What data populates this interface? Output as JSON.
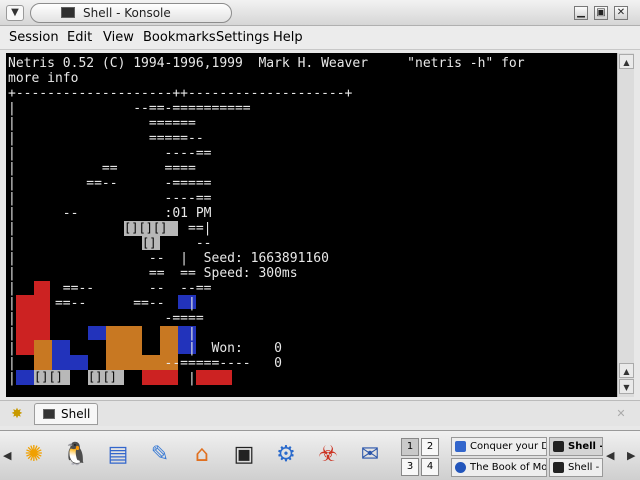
{
  "window": {
    "title": "Shell - Konsole",
    "menu_button_glyph": "▼",
    "buttons": {
      "minimize": "▁",
      "maximize": "▣",
      "close": "✕"
    }
  },
  "menubar": {
    "items": [
      "Session",
      "Edit",
      "View",
      "Bookmarks",
      "Settings",
      "Help"
    ]
  },
  "terminal": {
    "lines": [
      "Netris 0.52 (C) 1994-1996,1999  Mark H. Weaver     \"netris -h\" for",
      "more info",
      "+--------------------++--------------------+",
      "|               --==-==========",
      "|                 ======",
      "|                 =====--",
      "|                   ----==",
      "|           ==      ====",
      "|         ==--      -=====",
      "|                   ----==",
      "|      --           :01 PM",
      "|                      ==|",
      "|                       --",
      "|                 --  |  Seed: 1663891160",
      "|                 ==  == Speed: 300ms",
      "|      ==--       --  --==",
      "|     ==--      ==--   |",
      "|                   -====",
      "|                      |",
      "|                      |  Won:    0",
      "|                   --=====----   0",
      "|                      |"
    ],
    "gray_blocks": [
      "[][][]",
      "[]",
      "[][]",
      "[][]",
      "[][]"
    ],
    "block_colors": {
      "red": "#cc2222",
      "orange": "#c87822",
      "blue": "#2233bb",
      "gray": "#b8b8b8"
    }
  },
  "scrollbar": {
    "up_glyph": "▲",
    "down_glyph": "▼"
  },
  "tabbar": {
    "new_tab_icon": "new-session-icon",
    "tabs": [
      {
        "label": "Shell",
        "active": true
      }
    ],
    "close_glyph": "✕"
  },
  "panel": {
    "left_arrow": "◀",
    "right_arrow": "▶",
    "launchers": [
      {
        "name": "kde-menu-icon",
        "glyph": "✺",
        "color": "#f0a000"
      },
      {
        "name": "tux-icon",
        "glyph": "🐧",
        "color": "#000000"
      },
      {
        "name": "window-list-icon",
        "glyph": "▤",
        "color": "#3366cc"
      },
      {
        "name": "kcontrol-icon",
        "glyph": "✎",
        "color": "#3a7bd5"
      },
      {
        "name": "home-icon",
        "glyph": "⌂",
        "color": "#e07020"
      },
      {
        "name": "konsole-icon",
        "glyph": "▣",
        "color": "#222222"
      },
      {
        "name": "konqueror-icon",
        "glyph": "⚙",
        "color": "#2a6acc"
      },
      {
        "name": "game-icon",
        "glyph": "☣",
        "color": "#cc3322"
      },
      {
        "name": "writer-icon",
        "glyph": "✉",
        "color": "#2a55aa"
      }
    ],
    "desktops": [
      "1",
      "2",
      "3",
      "4"
    ],
    "tasks": [
      {
        "label": "Conquer your D",
        "icon_color": "#3366cc",
        "active": false
      },
      {
        "label": "Shell -",
        "icon_color": "#222222",
        "active": true
      },
      {
        "label": "The Book of Mo",
        "icon_color": "#2255bb",
        "active": false
      },
      {
        "label": "Shell -",
        "icon_color": "#222222",
        "active": false
      }
    ]
  }
}
